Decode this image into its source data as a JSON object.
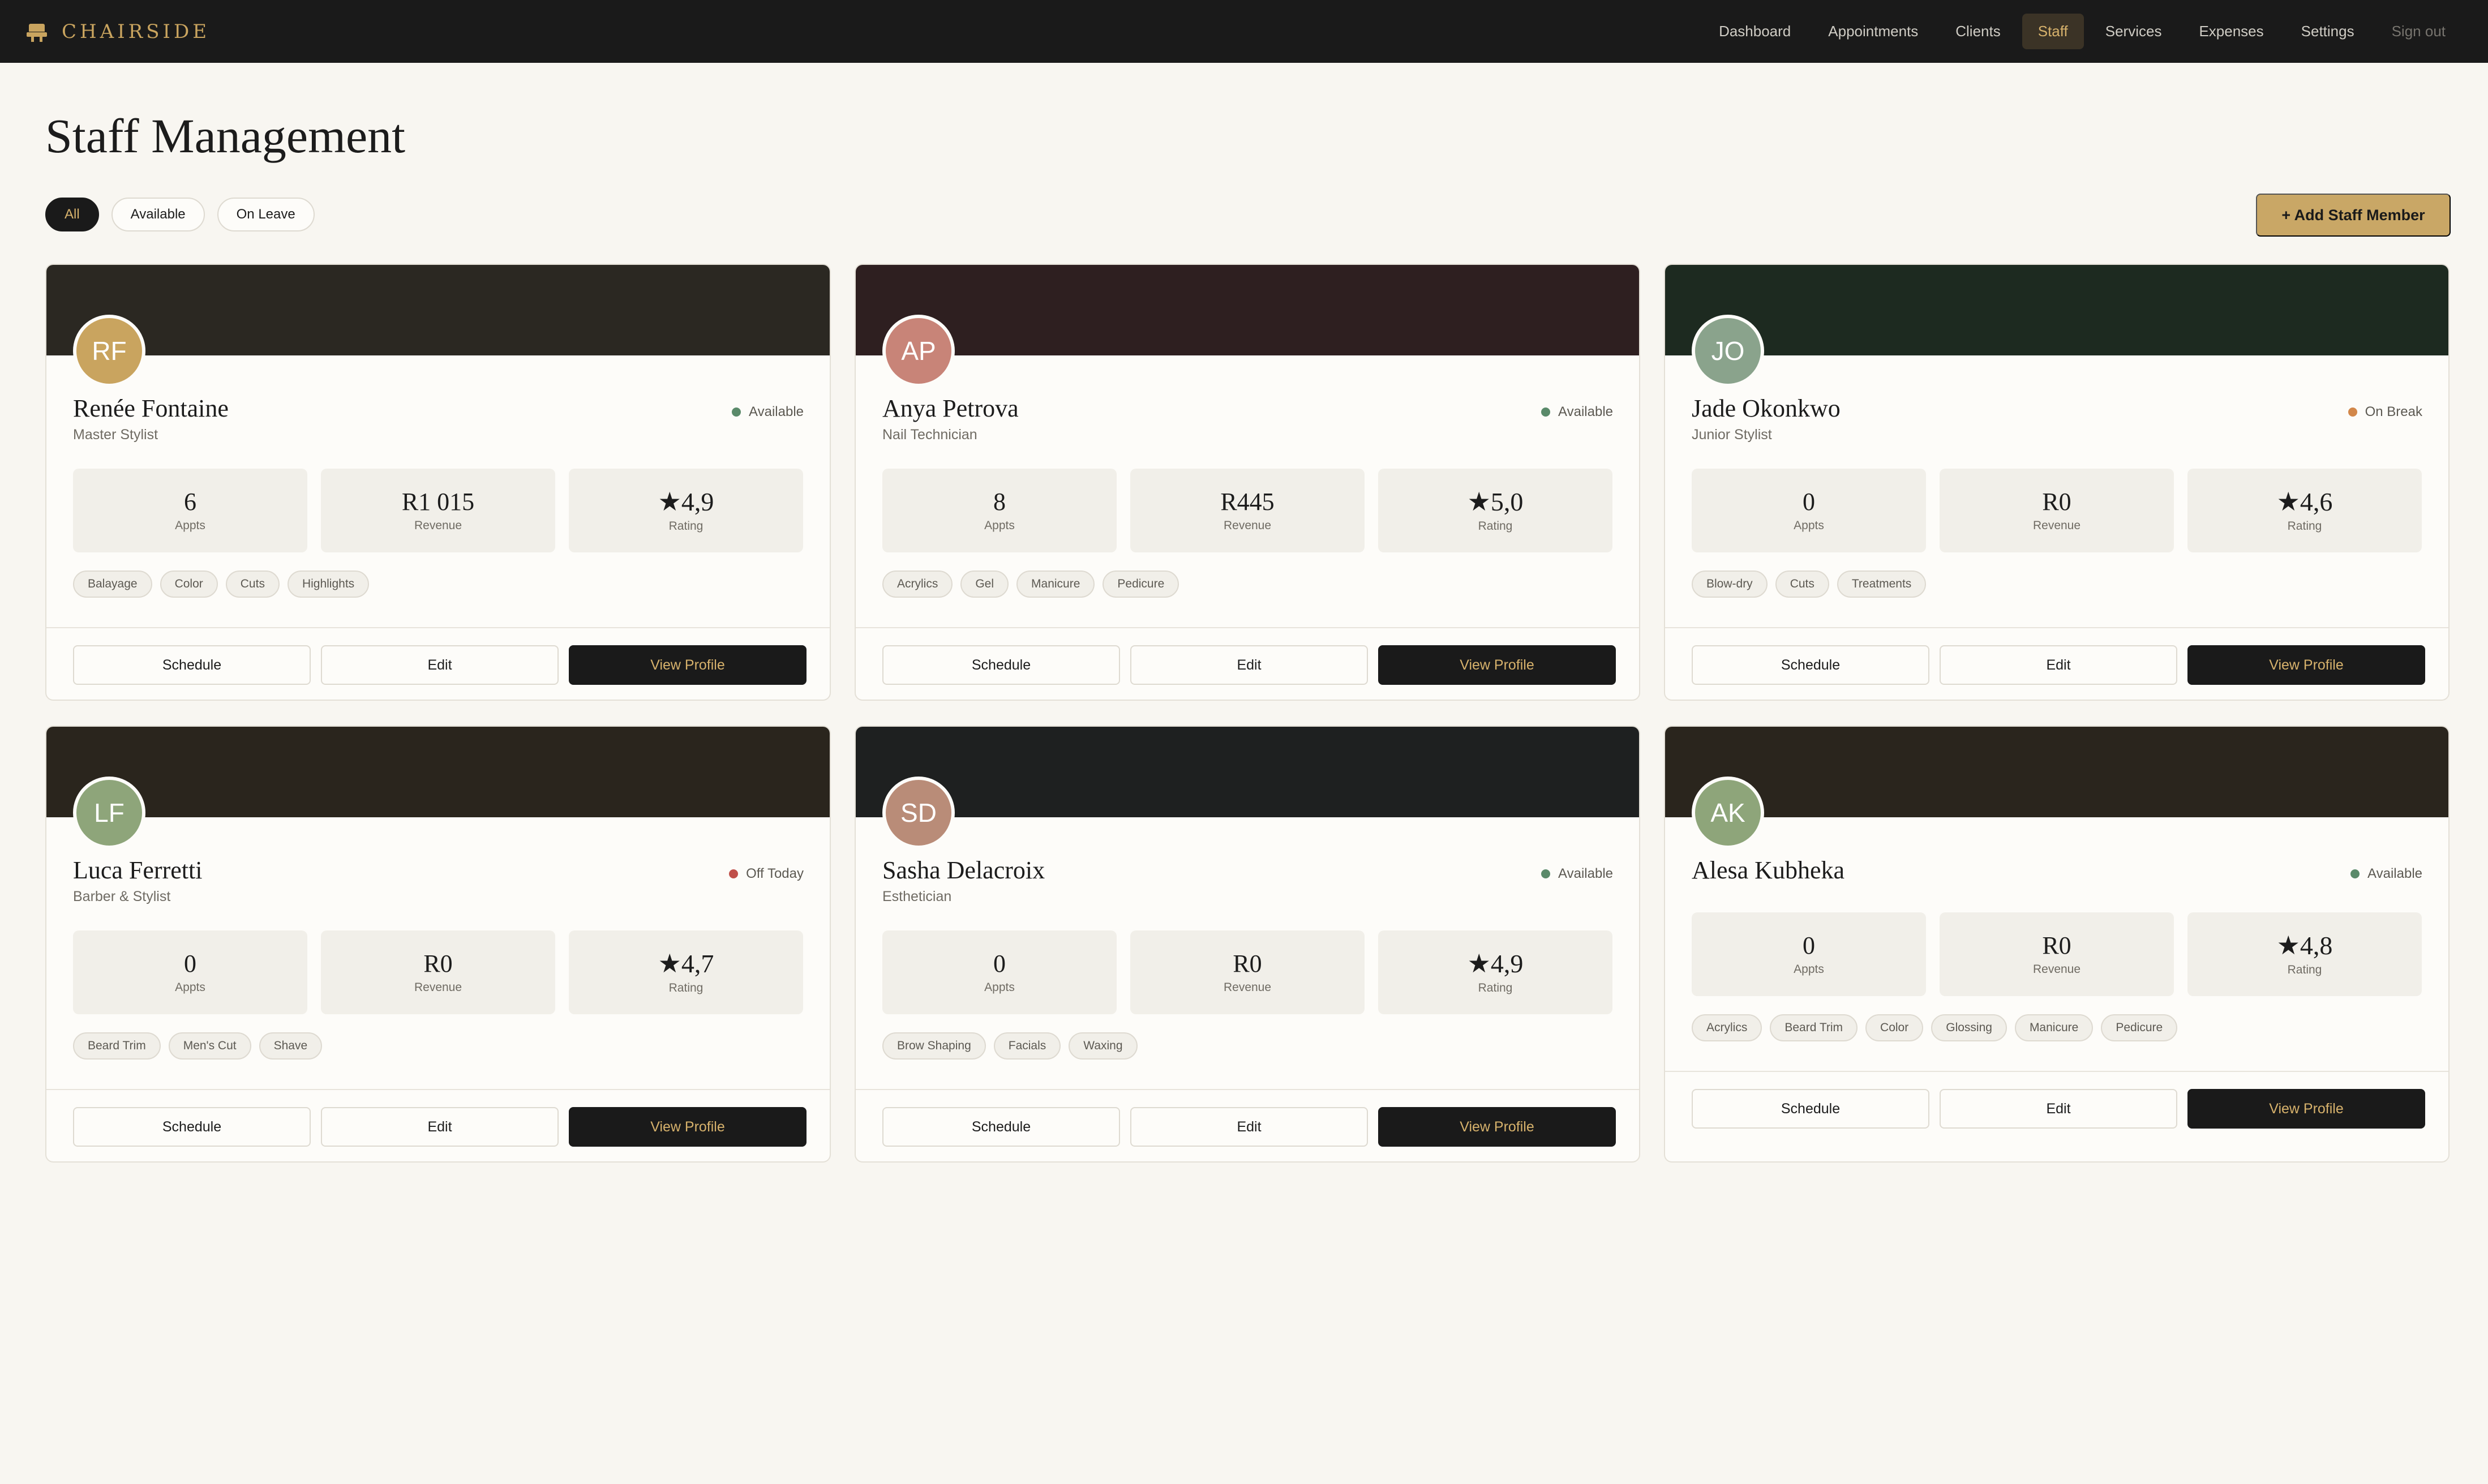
{
  "brand": {
    "name": "CHAIRSIDE",
    "icon": "salon-chair-icon",
    "color": "#c9a45f"
  },
  "nav": {
    "items": [
      {
        "label": "Dashboard"
      },
      {
        "label": "Appointments"
      },
      {
        "label": "Clients"
      },
      {
        "label": "Staff",
        "active": true
      },
      {
        "label": "Services"
      },
      {
        "label": "Expenses"
      },
      {
        "label": "Settings"
      }
    ],
    "signout": "Sign out"
  },
  "page": {
    "title": "Staff Management"
  },
  "filters": [
    {
      "label": "All",
      "active": true
    },
    {
      "label": "Available"
    },
    {
      "label": "On Leave"
    }
  ],
  "add_button": "+ Add Staff Member",
  "stat_labels": {
    "appts": "Appts",
    "revenue": "Revenue",
    "rating": "Rating"
  },
  "actions": {
    "schedule": "Schedule",
    "edit": "Edit",
    "view": "View Profile"
  },
  "staff": [
    {
      "initials": "RF",
      "name": "Renée Fontaine",
      "role": "Master Stylist",
      "status": "Available",
      "status_color": "#5a8a6a",
      "banner": "#2b2822",
      "avatar_color": "#c9a45f",
      "appts": "6",
      "revenue": "R1 015",
      "rating": "★4,9",
      "tags": [
        "Balayage",
        "Color",
        "Cuts",
        "Highlights"
      ]
    },
    {
      "initials": "AP",
      "name": "Anya Petrova",
      "role": "Nail Technician",
      "status": "Available",
      "status_color": "#5a8a6a",
      "banner": "#2e1f20",
      "avatar_color": "#c88478",
      "appts": "8",
      "revenue": "R445",
      "rating": "★5,0",
      "tags": [
        "Acrylics",
        "Gel",
        "Manicure",
        "Pedicure"
      ]
    },
    {
      "initials": "JO",
      "name": "Jade Okonkwo",
      "role": "Junior Stylist",
      "status": "On Break",
      "status_color": "#d2874a",
      "banner": "#1d2a20",
      "avatar_color": "#8aa38c",
      "appts": "0",
      "revenue": "R0",
      "rating": "★4,6",
      "tags": [
        "Blow-dry",
        "Cuts",
        "Treatments"
      ]
    },
    {
      "initials": "LF",
      "name": "Luca Ferretti",
      "role": "Barber & Stylist",
      "status": "Off Today",
      "status_color": "#c0504a",
      "banner": "#2a251d",
      "avatar_color": "#8ea57a",
      "appts": "0",
      "revenue": "R0",
      "rating": "★4,7",
      "tags": [
        "Beard Trim",
        "Men's Cut",
        "Shave"
      ]
    },
    {
      "initials": "SD",
      "name": "Sasha Delacroix",
      "role": "Esthetician",
      "status": "Available",
      "status_color": "#5a8a6a",
      "banner": "#1e2020",
      "avatar_color": "#b98c78",
      "appts": "0",
      "revenue": "R0",
      "rating": "★4,9",
      "tags": [
        "Brow Shaping",
        "Facials",
        "Waxing"
      ]
    },
    {
      "initials": "AK",
      "name": "Alesa Kubheka",
      "role": "",
      "status": "Available",
      "status_color": "#5a8a6a",
      "banner": "#2a251d",
      "avatar_color": "#8ea57a",
      "appts": "0",
      "revenue": "R0",
      "rating": "★4,8",
      "tags": [
        "Acrylics",
        "Beard Trim",
        "Color",
        "Glossing",
        "Manicure",
        "Pedicure"
      ]
    }
  ]
}
